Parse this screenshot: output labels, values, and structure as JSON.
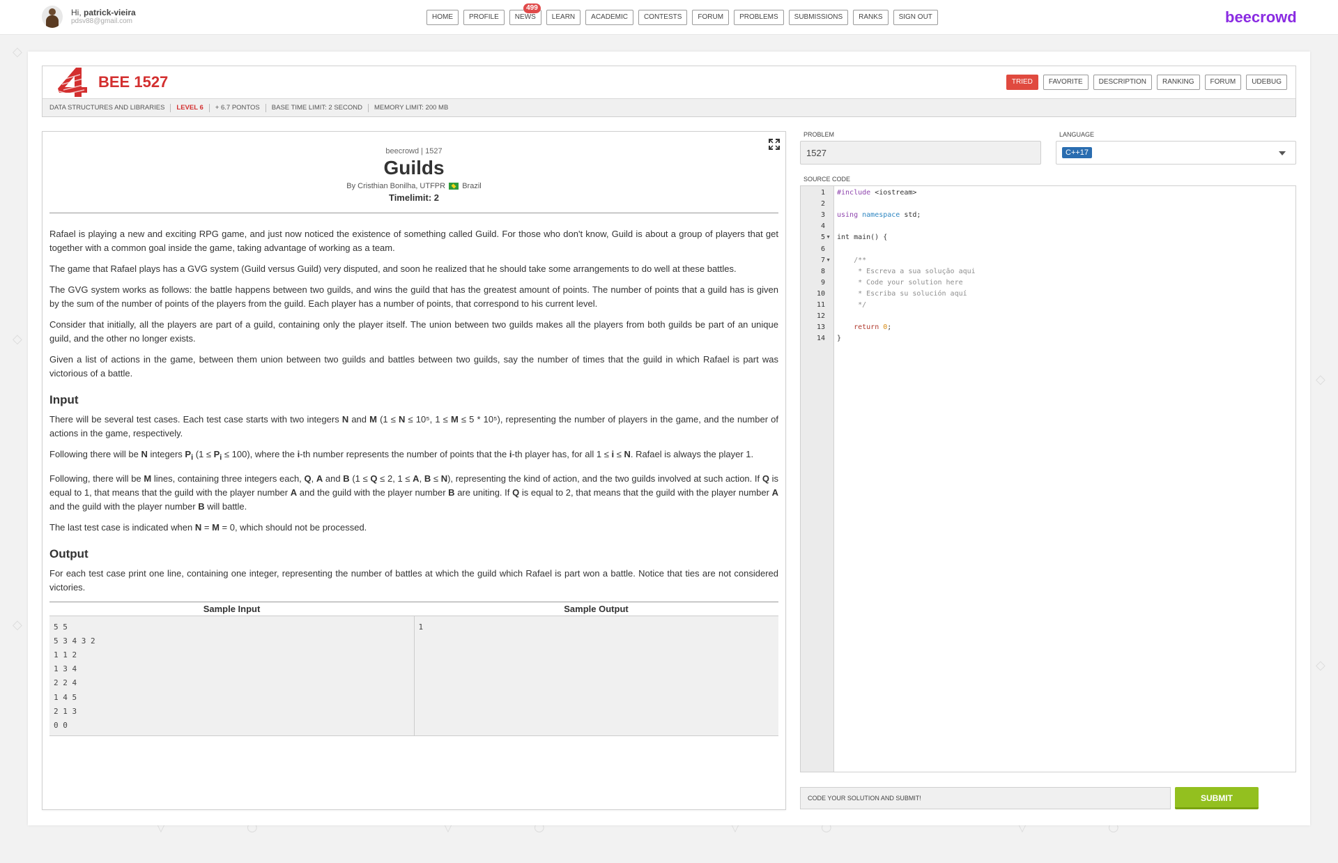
{
  "user": {
    "greeting_prefix": "Hi,",
    "username": "patrick-vieira",
    "email": "pdsv88@gmail.com"
  },
  "nav": [
    {
      "label": "HOME"
    },
    {
      "label": "PROFILE"
    },
    {
      "label": "NEWS",
      "badge": "499"
    },
    {
      "label": "LEARN"
    },
    {
      "label": "ACADEMIC"
    },
    {
      "label": "CONTESTS"
    },
    {
      "label": "FORUM"
    },
    {
      "label": "PROBLEMS"
    },
    {
      "label": "SUBMISSIONS"
    },
    {
      "label": "RANKS"
    },
    {
      "label": "SIGN OUT"
    }
  ],
  "brand": "beecrowd",
  "problem_header": {
    "title": "BEE 1527",
    "actions": [
      "TRIED",
      "FAVORITE",
      "DESCRIPTION",
      "RANKING",
      "FORUM",
      "UDEBUG"
    ],
    "meta": {
      "category": "DATA STRUCTURES AND LIBRARIES",
      "level": "LEVEL 6",
      "points": "+ 6.7 PONTOS",
      "time_limit": "BASE TIME LIMIT: 2 SECOND",
      "memory_limit": "MEMORY LIMIT: 200 MB"
    }
  },
  "problem": {
    "origin": "beecrowd | 1527",
    "title": "Guilds",
    "author_prefix": "By Cristhian Bonilha, UTFPR",
    "country": "Brazil",
    "timelimit": "Timelimit: 2",
    "statement": [
      "Rafael is playing a new and exciting RPG game, and just now noticed the existence of something called Guild. For those who don't know, Guild is about a group of players that get together with a common goal inside the game, taking advantage of working as a team.",
      "The game that Rafael plays has a GVG system (Guild versus Guild) very disputed, and soon he realized that he should take some arrangements to do well at these battles.",
      "The GVG system works as follows: the battle happens between two guilds, and wins the guild that has the greatest amount of points. The number of points that a guild has is given by the sum of the number of points of the players from the guild. Each player has a number of points, that correspond to his current level.",
      "Consider that initially, all the players are part of a guild, containing only the player itself. The union between two guilds makes all the players from both guilds be part of an unique guild, and the other no longer exists.",
      "Given a list of actions in the game, between them union between two guilds and battles between two guilds, say the number of times that the guild in which Rafael is part was victorious of a battle."
    ],
    "input_heading": "Input",
    "input_paragraphs": [
      "There will be several test cases. Each test case starts with two integers <b>N</b> and <b>M</b> (1 ≤ <b>N</b> ≤ 10⁵, 1 ≤ <b>M</b> ≤ 5 * 10⁵), representing the number of players in the game, and the number of actions in the game, respectively.",
      "Following there will be <b>N</b> integers <b>P<sub>i</sub></b> (1 ≤ <b>P<sub>i</sub></b> ≤ 100), where the <b>i</b>-th number represents the number of points that the <b>i</b>-th player has, for all 1 ≤ <b>i</b> ≤ <b>N</b>. Rafael is always the player 1.",
      "Following, there will be <b>M</b> lines, containing three integers each, <b>Q</b>, <b>A</b> and <b>B</b> (1 ≤ <b>Q</b> ≤ 2, 1 ≤ <b>A</b>, <b>B</b> ≤ <b>N</b>), representing the kind of action, and the two guilds involved at such action. If <b>Q</b> is equal to 1, that means that the guild with the player number <b>A</b> and the guild with the player number <b>B</b> are uniting. If <b>Q</b> is equal to 2, that means that the guild with the player number <b>A</b> and the guild with the player number <b>B</b> will battle.",
      "The last test case is indicated when <b>N</b> = <b>M</b> = 0, which should not be processed."
    ],
    "output_heading": "Output",
    "output_paragraphs": [
      "For each test case print one line, containing one integer, representing the number of battles at which the guild which Rafael is part won a battle. Notice that ties are not considered victories."
    ],
    "sample_input_label": "Sample Input",
    "sample_output_label": "Sample Output",
    "sample_input": "5 5\n5 3 4 3 2\n1 1 2\n1 3 4\n2 2 4\n1 4 5\n2 1 3\n0 0",
    "sample_output": "1"
  },
  "editor": {
    "problem_label": "PROBLEM",
    "problem_value": "1527",
    "language_label": "LANGUAGE",
    "language_value": "C++17",
    "source_label": "SOURCE CODE",
    "lines": [
      {
        "n": "1",
        "html": "<span class=\"kw-prep\">#include</span> &lt;iostream&gt;"
      },
      {
        "n": "2",
        "html": ""
      },
      {
        "n": "3",
        "html": "<span class=\"kw-prep\">using</span> <span class=\"kw-ns\">namespace</span> std;"
      },
      {
        "n": "4",
        "html": ""
      },
      {
        "n": "5",
        "html": "int main() {",
        "fold": true
      },
      {
        "n": "6",
        "html": ""
      },
      {
        "n": "7",
        "html": "    <span class=\"cmt\">/**</span>",
        "fold": true
      },
      {
        "n": "8",
        "html": "<span class=\"cmt\">     * Escreva a sua solução aqui</span>"
      },
      {
        "n": "9",
        "html": "<span class=\"cmt\">     * Code your solution here</span>"
      },
      {
        "n": "10",
        "html": "<span class=\"cmt\">     * Escriba su solución aquí</span>"
      },
      {
        "n": "11",
        "html": "<span class=\"cmt\">     */</span>"
      },
      {
        "n": "12",
        "html": ""
      },
      {
        "n": "13",
        "html": "    <span class=\"kw-ret\">return</span> <span class=\"num\">0</span>;"
      },
      {
        "n": "14",
        "html": "}"
      }
    ],
    "submit_hint": "CODE YOUR SOLUTION AND SUBMIT!",
    "submit_label": "SUBMIT"
  },
  "colors": {
    "brand": "#8a2be2",
    "title_red": "#d32f2f",
    "submit_green": "#93c01f",
    "tried_red": "#e04a3f"
  }
}
